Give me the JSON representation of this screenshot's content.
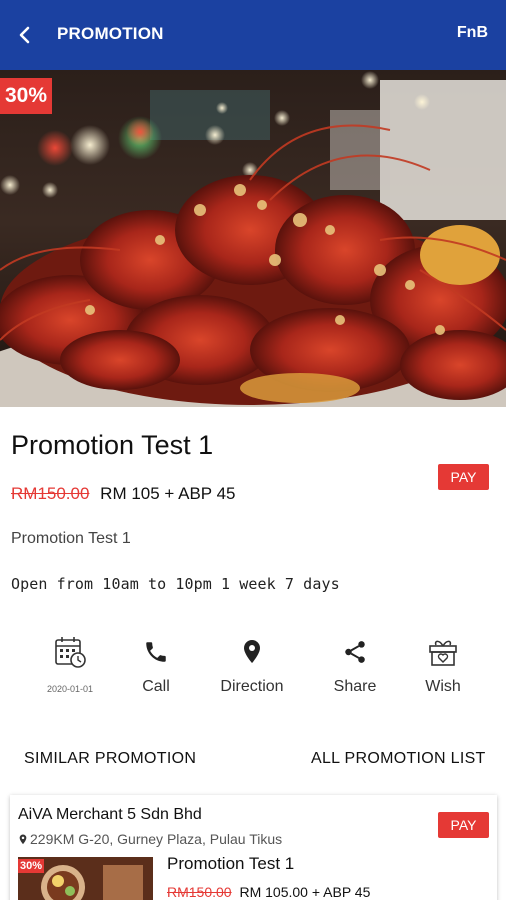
{
  "app_bar": {
    "title": "PROMOTION",
    "category": "FnB",
    "color": "#1b41a1"
  },
  "hero": {
    "discount_label": "30%",
    "image_subject": "plate of crawfish / crayfish"
  },
  "promotion": {
    "title": "Promotion Test 1",
    "old_price": "RM150.00",
    "new_price": "RM 105 + ABP 45",
    "pay_label": "PAY",
    "description": "Promotion Test 1",
    "hours": "Open from 10am to 10pm 1 week 7 days"
  },
  "actions": [
    {
      "icon": "calendar-clock-icon",
      "label": "2020-01-01"
    },
    {
      "icon": "phone-icon",
      "label": "Call"
    },
    {
      "icon": "location-pin-icon",
      "label": "Direction"
    },
    {
      "icon": "share-icon",
      "label": "Share"
    },
    {
      "icon": "gift-heart-icon",
      "label": "Wish"
    }
  ],
  "sections": {
    "similar": "SIMILAR PROMOTION",
    "all": "ALL PROMOTION LIST"
  },
  "similar_card": {
    "merchant": "AiVA Merchant 5 Sdn Bhd",
    "address": "229KM G-20, Gurney Plaza, Pulau Tikus",
    "pay_label": "PAY",
    "discount_label": "30%",
    "title": "Promotion Test 1",
    "old_price": "RM150.00",
    "new_price": "RM 105.00 + ABP 45"
  },
  "colors": {
    "accent_red": "#e53935",
    "primary_blue": "#1b41a1"
  }
}
